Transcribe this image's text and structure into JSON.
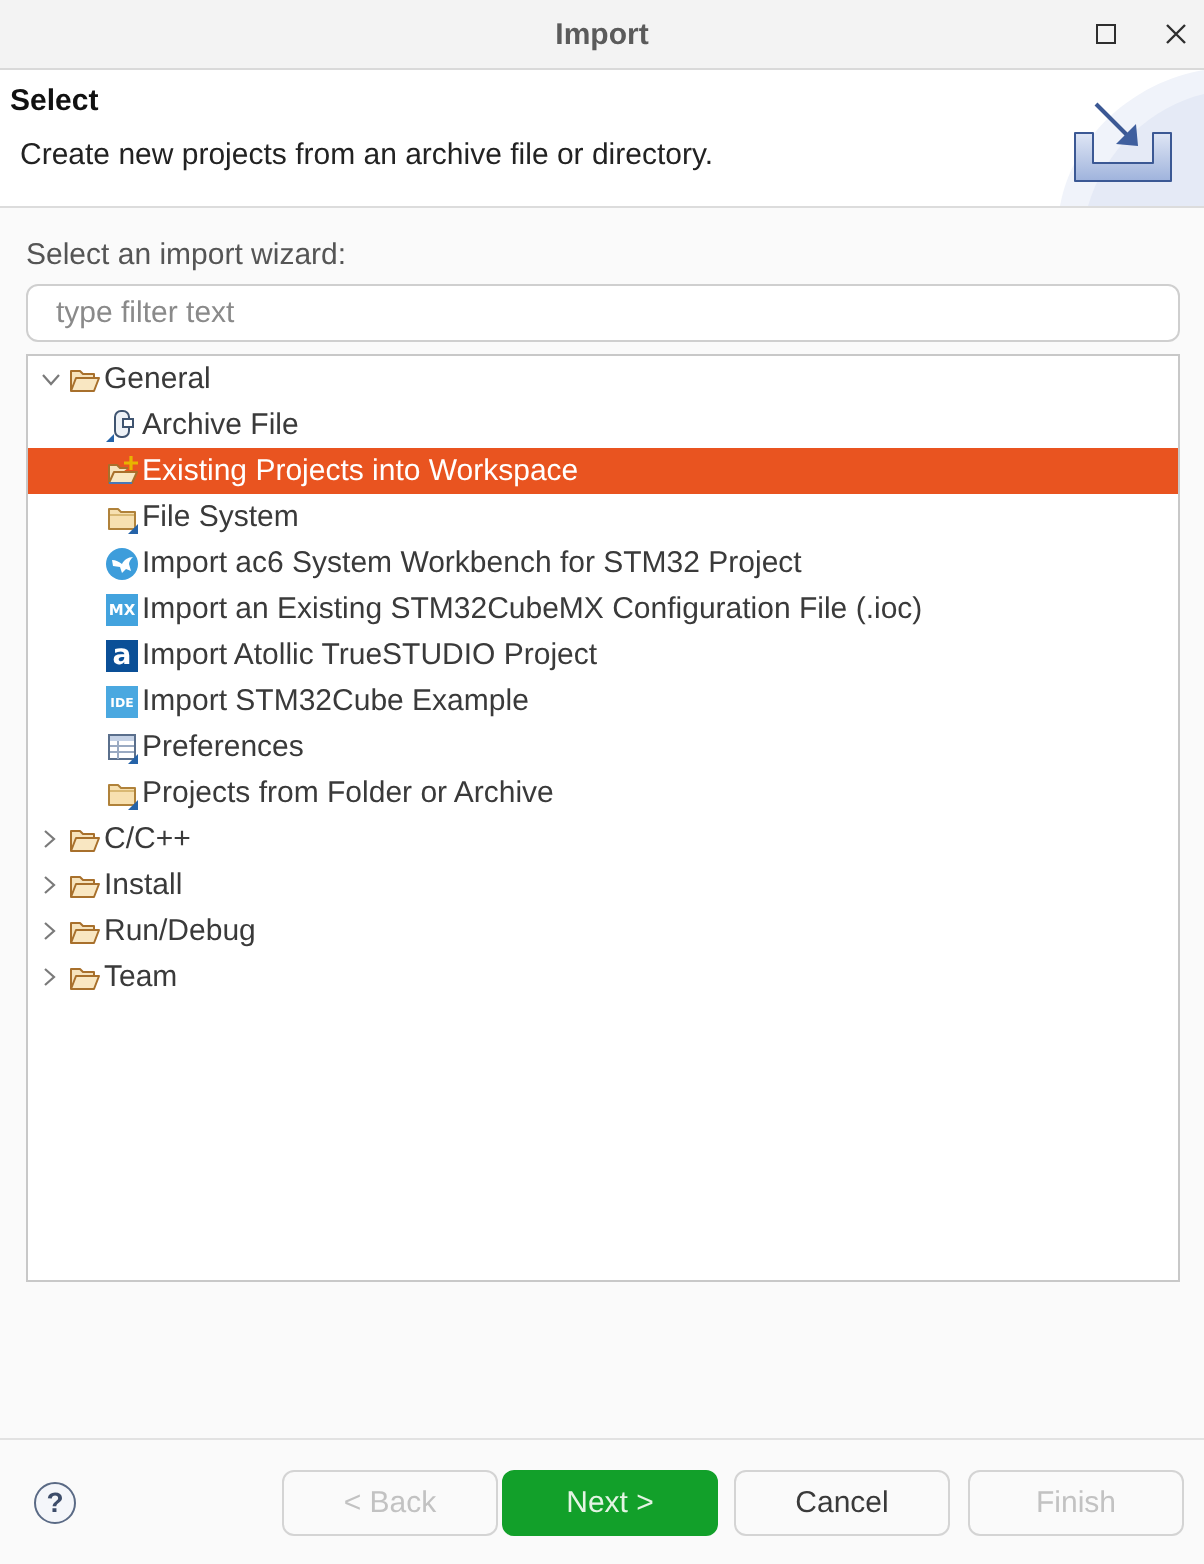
{
  "window": {
    "title": "Import"
  },
  "header": {
    "title": "Select",
    "description": "Create new projects from an archive file or directory."
  },
  "wizard_label": "Select an import wizard:",
  "filter": {
    "placeholder": "type filter text"
  },
  "tree": {
    "items": [
      {
        "label": "General",
        "expanded": true,
        "selected": false,
        "children": [
          {
            "label": "Archive File",
            "selected": false
          },
          {
            "label": "Existing Projects into Workspace",
            "selected": true
          },
          {
            "label": "File System",
            "selected": false
          },
          {
            "label": "Import ac6 System Workbench for STM32 Project",
            "selected": false
          },
          {
            "label": "Import an Existing STM32CubeMX Configuration File (.ioc)",
            "selected": false,
            "icon_text": "MX"
          },
          {
            "label": "Import Atollic TrueSTUDIO Project",
            "selected": false,
            "icon_text": "a"
          },
          {
            "label": "Import STM32Cube Example",
            "selected": false,
            "icon_text": "IDE"
          },
          {
            "label": "Preferences",
            "selected": false
          },
          {
            "label": "Projects from Folder or Archive",
            "selected": false
          }
        ]
      },
      {
        "label": "C/C++",
        "expanded": false,
        "selected": false
      },
      {
        "label": "Install",
        "expanded": false,
        "selected": false
      },
      {
        "label": "Run/Debug",
        "expanded": false,
        "selected": false
      },
      {
        "label": "Team",
        "expanded": false,
        "selected": false
      }
    ]
  },
  "help": {
    "glyph": "?"
  },
  "buttons": [
    {
      "label": "< Back",
      "disabled": true,
      "default": false
    },
    {
      "label": "Next >",
      "disabled": false,
      "default": true
    },
    {
      "label": "Cancel",
      "disabled": false,
      "default": false
    },
    {
      "label": "Finish",
      "disabled": true,
      "default": false
    }
  ]
}
